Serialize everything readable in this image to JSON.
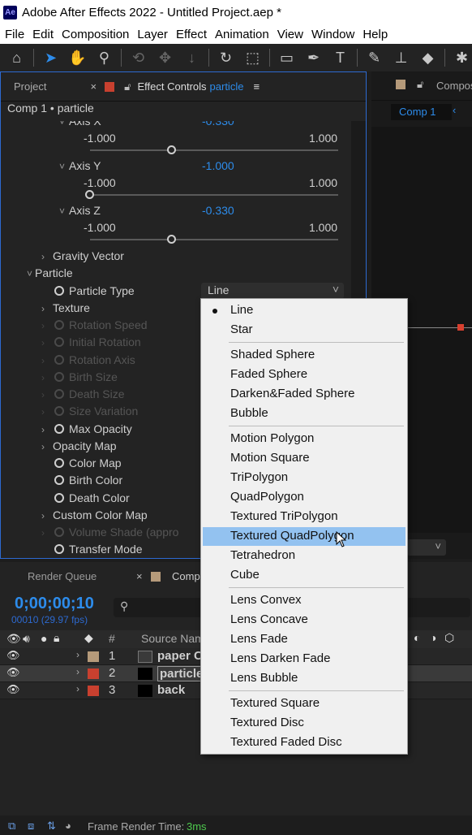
{
  "window": {
    "app_icon": "Ae",
    "title": "Adobe After Effects 2022 - Untitled Project.aep *"
  },
  "menu": [
    "File",
    "Edit",
    "Composition",
    "Layer",
    "Effect",
    "Animation",
    "View",
    "Window",
    "Help"
  ],
  "tools": [
    "home-icon",
    "selection-arrow-icon",
    "hand-icon",
    "zoom-icon",
    "orbit-icon",
    "pan-icon",
    "dolly-icon",
    "rotate-icon",
    "camera-icon",
    "rectangle-icon",
    "pen-icon",
    "type-icon",
    "brush-icon",
    "clone-stamp-icon",
    "eraser-icon",
    "puppet-icon"
  ],
  "left_panel": {
    "tab_project": "Project",
    "tab_effect_controls": "Effect Controls",
    "tab_effect_controls_layer": "particle",
    "subtitle": "Comp 1 • particle"
  },
  "effect_controls": {
    "axis_x": {
      "label": "Axis X",
      "value": "-0.330",
      "min": "-1.000",
      "max": "1.000",
      "knob_fraction": 0.33
    },
    "axis_y": {
      "label": "Axis Y",
      "value": "-1.000",
      "min": "-1.000",
      "max": "1.000",
      "knob_fraction": 0.0
    },
    "axis_z": {
      "label": "Axis Z",
      "value": "-0.330",
      "min": "-1.000",
      "max": "1.000",
      "knob_fraction": 0.33
    },
    "gravity_vector": "Gravity Vector",
    "particle": "Particle",
    "particle_type_label": "Particle Type",
    "particle_type_value": "Line",
    "texture": "Texture",
    "rotation_speed": "Rotation Speed",
    "initial_rotation": "Initial Rotation",
    "rotation_axis": "Rotation Axis",
    "birth_size": "Birth Size",
    "death_size": "Death Size",
    "size_variation": "Size Variation",
    "max_opacity": "Max Opacity",
    "opacity_map": "Opacity Map",
    "color_map": "Color Map",
    "birth_color": "Birth Color",
    "death_color": "Death Color",
    "custom_color_map": "Custom Color Map",
    "volume_shade": "Volume Shade (appro",
    "transfer_mode": "Transfer Mode"
  },
  "right_panel": {
    "tab": "Compos",
    "comp_tab": "Comp 1"
  },
  "timeline": {
    "tab_render_queue": "Render Queue",
    "tab_comp": "Comp",
    "timecode": "0;00;00;10",
    "fps": "00010 (29.97 fps)",
    "col_number": "#",
    "col_source": "Source Nam",
    "layers": [
      {
        "num": "1",
        "name": "paper C",
        "color": "#b59a7a"
      },
      {
        "num": "2",
        "name": "particle",
        "color": "#c8402f"
      },
      {
        "num": "3",
        "name": "back",
        "color": "#c8402f"
      }
    ]
  },
  "status": {
    "label": "Frame Render Time:",
    "value": "3ms"
  },
  "dropdown": {
    "groups": [
      [
        "Line",
        "Star"
      ],
      [
        "Shaded Sphere",
        "Faded Sphere",
        "Darken&Faded Sphere",
        "Bubble"
      ],
      [
        "Motion Polygon",
        "Motion Square",
        "TriPolygon",
        "QuadPolygon",
        "Textured TriPolygon",
        "Textured QuadPolygon",
        "Tetrahedron",
        "Cube"
      ],
      [
        "Lens Convex",
        "Lens Concave",
        "Lens Fade",
        "Lens Darken Fade",
        "Lens Bubble"
      ],
      [
        "Textured Square",
        "Textured Disc",
        "Textured Faded Disc"
      ]
    ],
    "selected": "Line",
    "hovered": "Textured QuadPolygon"
  }
}
